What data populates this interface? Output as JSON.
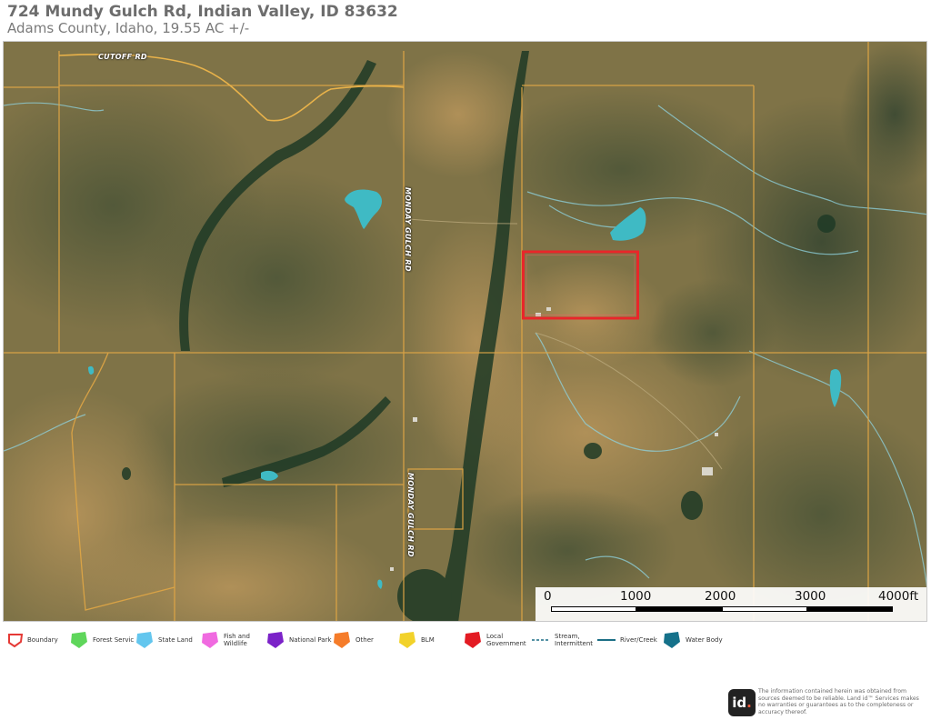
{
  "header": {
    "title": "724 Mundy Gulch Rd, Indian Valley, ID 83632",
    "subtitle": "Adams County, Idaho, 19.55 AC +/-"
  },
  "map": {
    "road_labels": {
      "cutoff": "CUTOFF RD",
      "monday_upper": "MONDAY GULCH RD",
      "monday_lower": "MONDAY GULCH RD"
    },
    "colors": {
      "parcel_line": "#e0a645",
      "boundary": "#e8262a",
      "road": "#e8b24a",
      "water": "#3fb8c2",
      "stream": "#7fc9d6"
    }
  },
  "scale": {
    "ticks": [
      "0",
      "1000",
      "2000",
      "3000",
      "4000ft"
    ]
  },
  "legend": [
    {
      "label": "Boundary",
      "color": "#e53935",
      "style": "outline"
    },
    {
      "label": "Forest Servic",
      "color": "#5fd65b",
      "style": "fill"
    },
    {
      "label": "State Land",
      "color": "#63c6ee",
      "style": "fill"
    },
    {
      "label": "Fish and Wildlife",
      "color": "#f06ae0",
      "style": "fill"
    },
    {
      "label": "National Park",
      "color": "#7b22c8",
      "style": "fill"
    },
    {
      "label": "Other",
      "color": "#f57c2a",
      "style": "fill"
    },
    {
      "label": "BLM",
      "color": "#f2d22a",
      "style": "fill"
    },
    {
      "label": "Local Government",
      "color": "#e31b23",
      "style": "fill"
    },
    {
      "label": "Stream, Intermittent",
      "color": "#1c6f86",
      "style": "dashed"
    },
    {
      "label": "River/Creek",
      "color": "#1c6f86",
      "style": "line"
    },
    {
      "label": "Water Body",
      "color": "#15718a",
      "style": "fill"
    }
  ],
  "footer": {
    "logo_text": "id",
    "logo_dot": ".",
    "disclaimer": "The information contained herein was obtained from sources deemed to be reliable. Land id™ Services makes no warranties or guarantees as to the completeness or accuracy thereof."
  }
}
